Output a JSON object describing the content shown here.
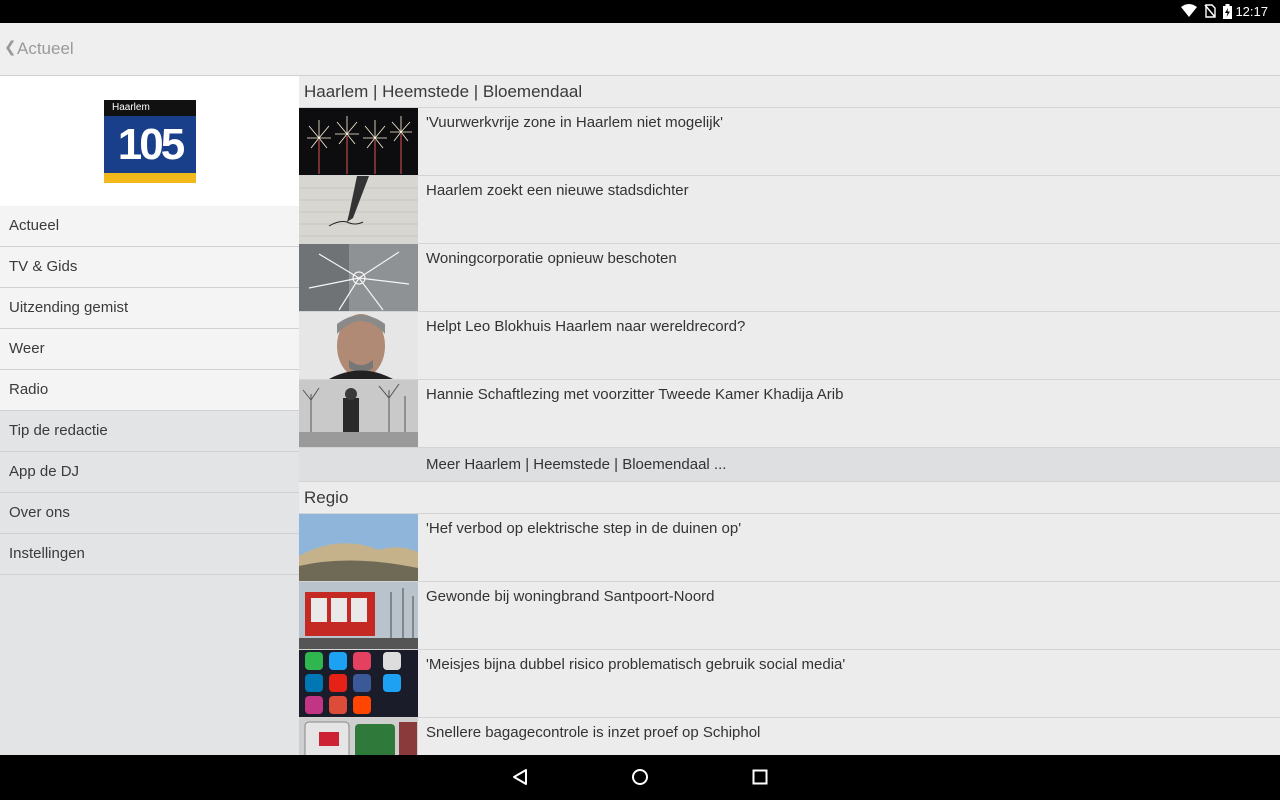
{
  "status_bar": {
    "time": "12:17"
  },
  "app_bar": {
    "back_label": "Actueel"
  },
  "logo": {
    "small_text": "Haarlem",
    "big_text": "105"
  },
  "menu": [
    {
      "label": "Actueel"
    },
    {
      "label": "TV & Gids"
    },
    {
      "label": "Uitzending gemist"
    },
    {
      "label": "Weer"
    },
    {
      "label": "Radio"
    },
    {
      "label": "Tip de redactie"
    },
    {
      "label": "App de DJ"
    },
    {
      "label": "Over ons"
    },
    {
      "label": "Instellingen"
    }
  ],
  "sections": [
    {
      "title": "Haarlem | Heemstede | Bloemendaal",
      "articles": [
        {
          "headline": "'Vuurwerkvrije zone in Haarlem niet mogelijk'"
        },
        {
          "headline": "Haarlem zoekt een nieuwe stadsdichter"
        },
        {
          "headline": "Woningcorporatie opnieuw beschoten"
        },
        {
          "headline": "Helpt Leo Blokhuis Haarlem naar wereldrecord?"
        },
        {
          "headline": "Hannie Schaftlezing met voorzitter Tweede Kamer Khadija Arib"
        }
      ],
      "more_label": "Meer Haarlem | Heemstede | Bloemendaal ..."
    },
    {
      "title": "Regio",
      "articles": [
        {
          "headline": "'Hef verbod op elektrische step in de duinen op'"
        },
        {
          "headline": "Gewonde bij woningbrand Santpoort-Noord"
        },
        {
          "headline": "'Meisjes bijna dubbel risico problematisch gebruik social media'"
        },
        {
          "headline": "Snellere bagagecontrole is inzet proef op Schiphol"
        }
      ]
    }
  ],
  "colors": {
    "logo_blue": "#1a3f8a",
    "logo_yellow": "#f3b81a",
    "sidebar_bg": "#e3e4e6"
  },
  "icons": {
    "back": "chevron-left-icon",
    "wifi": "wifi-icon",
    "nosim": "no-sim-icon",
    "battery": "battery-charging-icon",
    "nav_back": "nav-back-icon",
    "nav_home": "nav-home-icon",
    "nav_recents": "nav-recents-icon"
  }
}
